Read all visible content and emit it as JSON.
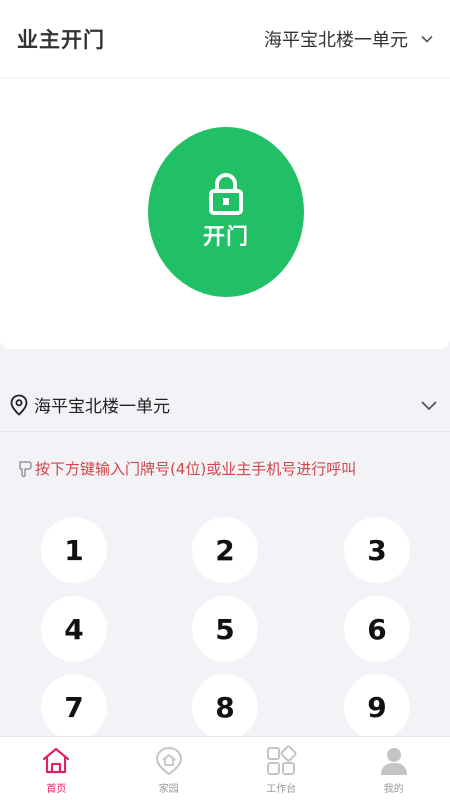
{
  "header": {
    "title": "业主开门",
    "building": "海平宝北楼一单元"
  },
  "open_button": {
    "label": "开门"
  },
  "location": {
    "text": "海平宝北楼一单元"
  },
  "hint": {
    "text": "按下方键输入门牌号(4位)或业主手机号进行呼叫"
  },
  "keypad": {
    "keys": [
      "1",
      "2",
      "3",
      "4",
      "5",
      "6",
      "7",
      "8",
      "9"
    ]
  },
  "tabbar": {
    "items": [
      {
        "label": "首页",
        "icon": "home-icon",
        "active": true
      },
      {
        "label": "家园",
        "icon": "community-icon",
        "active": false
      },
      {
        "label": "工作台",
        "icon": "workbench-icon",
        "active": false
      },
      {
        "label": "我的",
        "icon": "profile-icon",
        "active": false
      }
    ]
  },
  "colors": {
    "accent_green": "#21bf66",
    "hint_red": "#d0474a",
    "tab_active": "#e0245e"
  }
}
